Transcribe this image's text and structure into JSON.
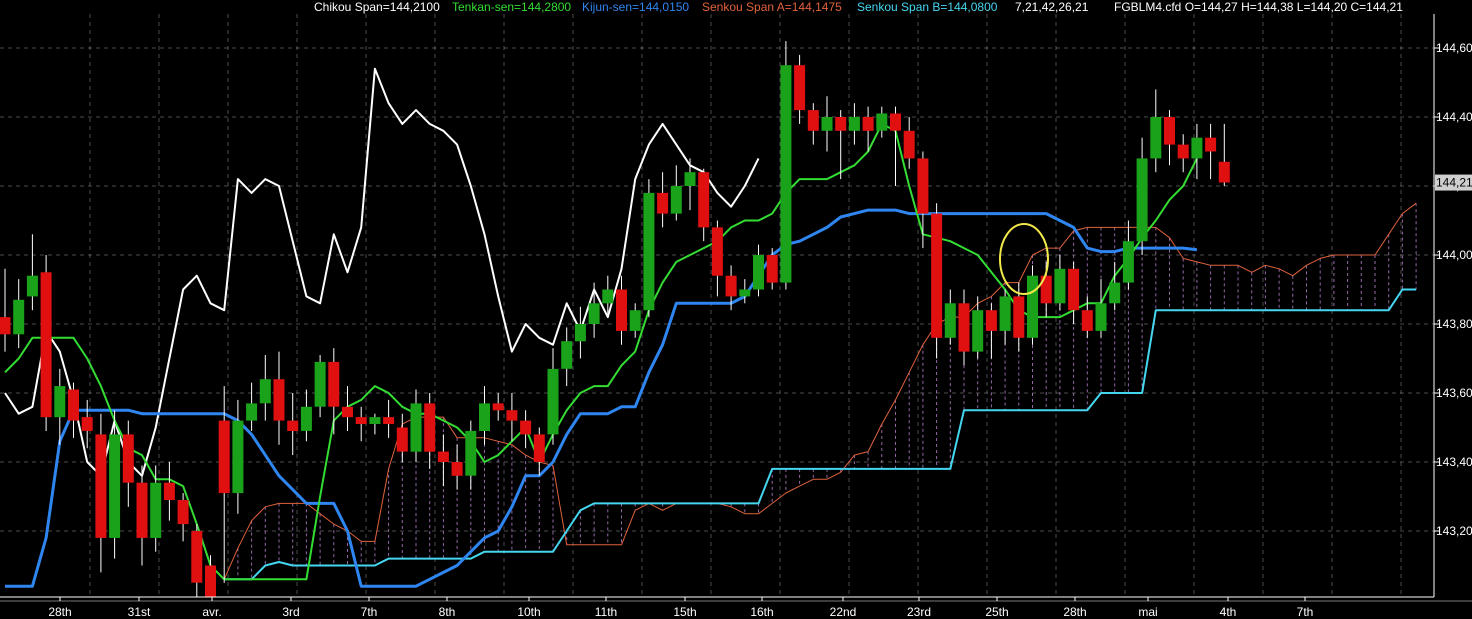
{
  "header": {
    "chikou": "Chikou Span=144,2100",
    "tenkan": "Tenkan-sen=144,2800",
    "kijun": "Kijun-sen=144,0150",
    "span_a": "Senkou Span A=144,1475",
    "span_b": "Senkou Span B=144,0800",
    "params": "7,21,42,26,21",
    "ohlc": "FGBLM4.cfd O=144,27 H=144,38 L=144,20 C=144,21"
  },
  "colors": {
    "background": "#000000",
    "grid": "#8a8a8a",
    "bull": "#1aa31a",
    "bear": "#e01010",
    "chikou": "#ffffff",
    "tenkan": "#33dd33",
    "kijun": "#2f86f0",
    "span_a": "#e0623c",
    "span_b": "#45d6f0",
    "cloud": "#c78be0",
    "highlight": "#f2e84a"
  },
  "price_badge": "144,21",
  "chart_data": {
    "type": "candlestick",
    "title": "",
    "symbol": "FGBLM4.cfd",
    "ylim": [
      143.04,
      144.7
    ],
    "y_ticks": [
      "144,60",
      "144,40",
      "144,20",
      "144,00",
      "143,80",
      "143,60",
      "143,40",
      "143,20"
    ],
    "y_tick_values": [
      144.6,
      144.4,
      144.2,
      144.0,
      143.8,
      143.6,
      143.4,
      143.2
    ],
    "x_labels": [
      "28th",
      "31st",
      "avr.",
      "3rd",
      "7th",
      "8th",
      "10th",
      "11th",
      "15th",
      "16th",
      "22nd",
      "23rd",
      "25th",
      "28th",
      "mai",
      "4th",
      "7th"
    ],
    "x_label_index": [
      4,
      10,
      16,
      22,
      28,
      34,
      40,
      46,
      52,
      58,
      64,
      70,
      76,
      82,
      88,
      94,
      100
    ],
    "x_count": 106,
    "grid": true,
    "candles": [
      [
        143.82,
        143.77,
        143.96,
        143.72
      ],
      [
        143.77,
        143.87,
        143.93,
        143.73
      ],
      [
        143.88,
        143.94,
        144.06,
        143.84
      ],
      [
        143.95,
        143.53,
        144.0,
        143.49
      ],
      [
        143.53,
        143.62,
        143.67,
        143.45
      ],
      [
        143.61,
        143.52,
        143.63,
        143.47
      ],
      [
        143.53,
        143.49,
        143.58,
        143.44
      ],
      [
        143.48,
        143.18,
        143.54,
        143.08
      ],
      [
        143.18,
        143.48,
        143.55,
        143.12
      ],
      [
        143.48,
        143.34,
        143.52,
        143.27
      ],
      [
        143.34,
        143.18,
        143.39,
        143.1
      ],
      [
        143.18,
        143.34,
        143.39,
        143.14
      ],
      [
        143.34,
        143.29,
        143.4,
        143.23
      ],
      [
        143.29,
        143.22,
        143.31,
        143.17
      ],
      [
        143.2,
        143.05,
        143.22,
        143.0
      ],
      [
        143.1,
        143.0,
        143.13,
        142.98
      ],
      [
        143.52,
        143.31,
        143.62,
        143.05
      ],
      [
        143.31,
        143.52,
        143.58,
        143.25
      ],
      [
        143.52,
        143.57,
        143.63,
        143.49
      ],
      [
        143.57,
        143.64,
        143.71,
        143.52
      ],
      [
        143.64,
        143.52,
        143.72,
        143.45
      ],
      [
        143.52,
        143.49,
        143.6,
        143.42
      ],
      [
        143.49,
        143.56,
        143.61,
        143.46
      ],
      [
        143.56,
        143.69,
        143.71,
        143.53
      ],
      [
        143.69,
        143.56,
        143.73,
        143.48
      ],
      [
        143.56,
        143.53,
        143.62,
        143.49
      ],
      [
        143.53,
        143.51,
        143.56,
        143.46
      ],
      [
        143.51,
        143.53,
        143.54,
        143.48
      ],
      [
        143.53,
        143.51,
        143.58,
        143.47
      ],
      [
        143.5,
        143.43,
        143.54,
        143.4
      ],
      [
        143.43,
        143.57,
        143.61,
        143.4
      ],
      [
        143.57,
        143.43,
        143.6,
        143.38
      ],
      [
        143.43,
        143.4,
        143.48,
        143.33
      ],
      [
        143.4,
        143.36,
        143.45,
        143.32
      ],
      [
        143.36,
        143.49,
        143.52,
        143.32
      ],
      [
        143.49,
        143.57,
        143.62,
        143.45
      ],
      [
        143.57,
        143.55,
        143.6,
        143.52
      ],
      [
        143.55,
        143.52,
        143.6,
        143.46
      ],
      [
        143.52,
        143.48,
        143.55,
        143.44
      ],
      [
        143.48,
        143.4,
        143.5,
        143.36
      ],
      [
        143.48,
        143.67,
        143.73,
        143.45
      ],
      [
        143.67,
        143.75,
        143.79,
        143.62
      ],
      [
        143.75,
        143.8,
        143.85,
        143.7
      ],
      [
        143.8,
        143.86,
        143.92,
        143.76
      ],
      [
        143.86,
        143.9,
        143.94,
        143.82
      ],
      [
        143.9,
        143.78,
        143.94,
        143.74
      ],
      [
        143.78,
        143.84,
        143.86,
        143.76
      ],
      [
        143.84,
        144.18,
        144.22,
        143.82
      ],
      [
        144.18,
        144.12,
        144.24,
        144.08
      ],
      [
        144.12,
        144.2,
        144.26,
        144.1
      ],
      [
        144.2,
        144.24,
        144.28,
        144.13
      ],
      [
        144.24,
        144.08,
        144.25,
        144.04
      ],
      [
        144.08,
        143.94,
        144.1,
        143.88
      ],
      [
        143.94,
        143.88,
        143.97,
        143.84
      ],
      [
        143.88,
        143.9,
        143.93,
        143.86
      ],
      [
        143.9,
        144.0,
        144.03,
        143.88
      ],
      [
        144.0,
        143.92,
        144.02,
        143.9
      ],
      [
        143.92,
        144.55,
        144.62,
        143.9
      ],
      [
        144.55,
        144.42,
        144.58,
        144.38
      ],
      [
        144.42,
        144.36,
        144.44,
        144.32
      ],
      [
        144.36,
        144.4,
        144.46,
        144.3
      ],
      [
        144.4,
        144.36,
        144.42,
        144.22
      ],
      [
        144.36,
        144.4,
        144.44,
        144.32
      ],
      [
        144.4,
        144.36,
        144.43,
        144.3
      ],
      [
        144.36,
        144.41,
        144.43,
        144.34
      ],
      [
        144.41,
        144.36,
        144.43,
        144.2
      ],
      [
        144.36,
        144.28,
        144.4,
        144.25
      ],
      [
        144.28,
        144.12,
        144.3,
        144.02
      ],
      [
        144.12,
        143.76,
        144.15,
        143.7
      ],
      [
        143.76,
        143.86,
        143.9,
        143.74
      ],
      [
        143.86,
        143.72,
        143.9,
        143.68
      ],
      [
        143.72,
        143.84,
        143.88,
        143.7
      ],
      [
        143.84,
        143.78,
        143.86,
        143.7
      ],
      [
        143.78,
        143.88,
        143.9,
        143.74
      ],
      [
        143.88,
        143.76,
        143.92,
        143.72
      ],
      [
        143.76,
        143.94,
        143.97,
        143.74
      ],
      [
        143.94,
        143.86,
        143.98,
        143.82
      ],
      [
        143.86,
        143.96,
        144.0,
        143.84
      ],
      [
        143.96,
        143.84,
        143.98,
        143.8
      ],
      [
        143.84,
        143.78,
        143.88,
        143.76
      ],
      [
        143.78,
        143.86,
        143.93,
        143.76
      ],
      [
        143.86,
        143.92,
        143.98,
        143.84
      ],
      [
        143.92,
        144.04,
        144.1,
        143.9
      ],
      [
        144.04,
        144.28,
        144.34,
        144.0
      ],
      [
        144.28,
        144.4,
        144.48,
        144.24
      ],
      [
        144.4,
        144.32,
        144.42,
        144.26
      ],
      [
        144.32,
        144.28,
        144.35,
        144.24
      ],
      [
        144.28,
        144.34,
        144.38,
        144.22
      ],
      [
        144.34,
        144.3,
        144.38,
        144.22
      ],
      [
        144.27,
        144.21,
        144.38,
        144.2
      ]
    ],
    "series": [
      {
        "name": "Chikou Span",
        "values": [
          143.6,
          143.54,
          143.56,
          143.78,
          143.72,
          143.58,
          143.4,
          143.36,
          143.52,
          143.4,
          143.36,
          143.5,
          143.7,
          143.9,
          143.94,
          143.86,
          143.84,
          144.22,
          144.18,
          144.22,
          144.2,
          144.04,
          143.88,
          143.86,
          144.06,
          143.95,
          144.08,
          144.54,
          144.44,
          144.38,
          144.42,
          144.38,
          144.36,
          144.32,
          144.2,
          144.06,
          143.88,
          143.72,
          143.8,
          143.76,
          143.74,
          143.86,
          143.78,
          143.9,
          143.82,
          143.96,
          144.22,
          144.32,
          144.38,
          144.32,
          144.26,
          144.24,
          144.18,
          144.14,
          144.2,
          144.28
        ]
      },
      {
        "name": "Tenkan-sen",
        "values": [
          143.66,
          143.7,
          143.76,
          143.76,
          143.76,
          143.76,
          143.7,
          143.62,
          143.52,
          143.44,
          143.42,
          143.35,
          143.35,
          143.33,
          143.22,
          143.1,
          143.06,
          143.06,
          143.06,
          143.06,
          143.06,
          143.06,
          143.06,
          143.3,
          143.52,
          143.56,
          143.58,
          143.62,
          143.6,
          143.56,
          143.54,
          143.54,
          143.52,
          143.5,
          143.46,
          143.4,
          143.42,
          143.46,
          143.5,
          143.4,
          143.48,
          143.55,
          143.6,
          143.62,
          143.62,
          143.68,
          143.72,
          143.84,
          143.92,
          143.98,
          144.0,
          144.02,
          144.04,
          144.08,
          144.1,
          144.1,
          144.12,
          144.18,
          144.22,
          144.22,
          144.22,
          144.24,
          144.26,
          144.3,
          144.38,
          144.36,
          144.2,
          144.06,
          144.05,
          144.04,
          144.02,
          144.0,
          143.95,
          143.9,
          143.84,
          143.82,
          143.82,
          143.82,
          143.84,
          143.86,
          143.86,
          143.94,
          143.99,
          144.05,
          144.1,
          144.16,
          144.2,
          144.28
        ]
      },
      {
        "name": "Kijun-sen",
        "values": [
          143.04,
          143.04,
          143.04,
          143.18,
          143.46,
          143.55,
          143.55,
          143.55,
          143.55,
          143.55,
          143.54,
          143.54,
          143.54,
          143.54,
          143.54,
          143.54,
          143.54,
          143.52,
          143.48,
          143.42,
          143.36,
          143.32,
          143.28,
          143.28,
          143.28,
          143.2,
          143.04,
          143.04,
          143.04,
          143.04,
          143.04,
          143.06,
          143.08,
          143.1,
          143.14,
          143.18,
          143.2,
          143.27,
          143.36,
          143.36,
          143.4,
          143.48,
          143.54,
          143.54,
          143.54,
          143.56,
          143.56,
          143.66,
          143.74,
          143.86,
          143.86,
          143.86,
          143.86,
          143.86,
          143.88,
          143.94,
          144.0,
          144.03,
          144.04,
          144.06,
          144.08,
          144.11,
          144.12,
          144.13,
          144.13,
          144.13,
          144.12,
          144.12,
          144.12,
          144.12,
          144.12,
          144.12,
          144.12,
          144.12,
          144.12,
          144.12,
          144.12,
          144.1,
          144.08,
          144.02,
          144.01,
          144.01,
          144.02,
          144.02,
          144.02,
          144.02,
          144.02,
          144.015
        ]
      },
      {
        "name": "Senkou Span A",
        "values": [
          143.06,
          143.15,
          143.23,
          143.27,
          143.28,
          143.28,
          143.28,
          143.25,
          143.22,
          143.2,
          143.17,
          143.17,
          143.38,
          143.51,
          143.53,
          143.53,
          143.53,
          143.47,
          143.47,
          143.47,
          143.46,
          143.45,
          143.42,
          143.4,
          143.39,
          143.16,
          143.16,
          143.16,
          143.16,
          143.16,
          143.26,
          143.28,
          143.26,
          143.28,
          143.28,
          143.28,
          143.28,
          143.27,
          143.25,
          143.25,
          143.28,
          143.31,
          143.33,
          143.35,
          143.35,
          143.37,
          143.42,
          143.43,
          143.51,
          143.58,
          143.66,
          143.74,
          143.8,
          143.82,
          143.82,
          143.86,
          143.88,
          143.92,
          143.92,
          144.0,
          144.02,
          144.02,
          144.07,
          144.08,
          144.08,
          144.08,
          144.08,
          144.08,
          144.08,
          144.05,
          143.99,
          143.98,
          143.97,
          143.97,
          143.97,
          143.95,
          143.97,
          143.96,
          143.94,
          143.97,
          143.99,
          144.0,
          144.0,
          144.0,
          144.0,
          144.06,
          144.12,
          144.15
        ]
      },
      {
        "name": "Senkou Span B",
        "values": [
          143.06,
          143.06,
          143.06,
          143.1,
          143.11,
          143.1,
          143.1,
          143.1,
          143.1,
          143.1,
          143.1,
          143.1,
          143.12,
          143.12,
          143.12,
          143.12,
          143.12,
          143.12,
          143.12,
          143.14,
          143.14,
          143.14,
          143.14,
          143.14,
          143.14,
          143.2,
          143.26,
          143.28,
          143.28,
          143.28,
          143.28,
          143.28,
          143.28,
          143.28,
          143.28,
          143.28,
          143.28,
          143.28,
          143.28,
          143.28,
          143.38,
          143.38,
          143.38,
          143.38,
          143.38,
          143.38,
          143.38,
          143.38,
          143.38,
          143.38,
          143.38,
          143.38,
          143.38,
          143.38,
          143.55,
          143.55,
          143.55,
          143.55,
          143.55,
          143.55,
          143.55,
          143.55,
          143.55,
          143.55,
          143.6,
          143.6,
          143.6,
          143.6,
          143.84,
          143.84,
          143.84,
          143.84,
          143.84,
          143.84,
          143.84,
          143.84,
          143.84,
          143.84,
          143.84,
          143.84,
          143.84,
          143.84,
          143.84,
          143.84,
          143.84,
          143.84,
          143.9,
          143.9
        ]
      }
    ]
  }
}
